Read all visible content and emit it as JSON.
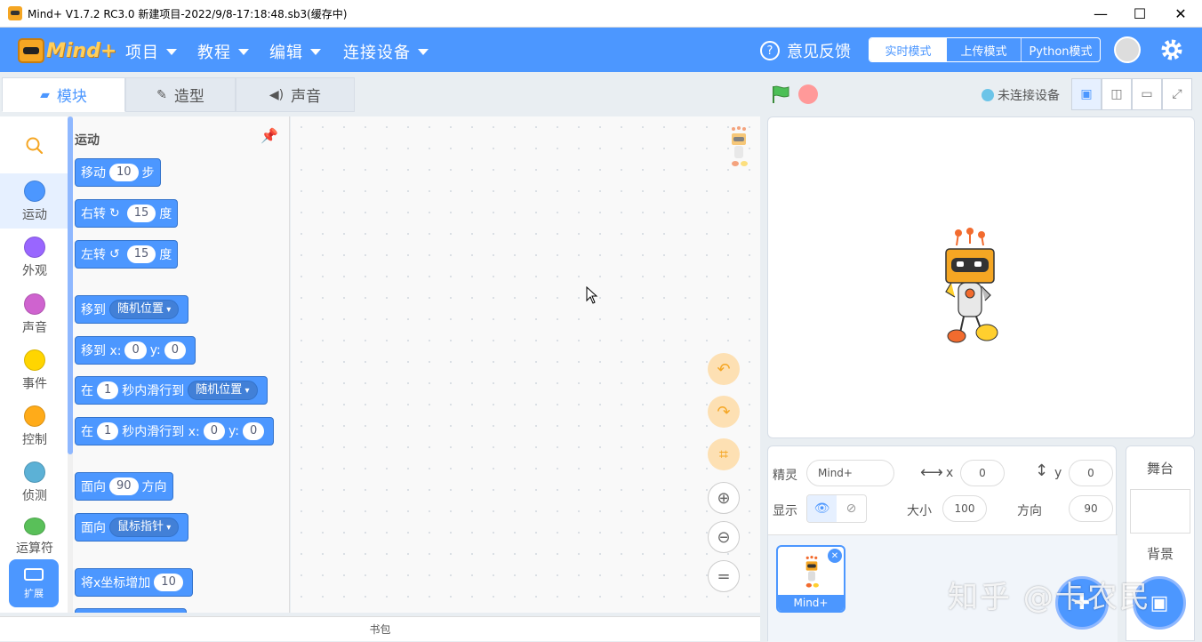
{
  "window": {
    "title": "Mind+ V1.7.2 RC3.0   新建项目-2022/9/8-17:18:48.sb3(缓存中)",
    "minimize": "—",
    "maximize": "☐",
    "close": "✕"
  },
  "menubar": {
    "logo_text": "Mind+",
    "items": [
      "项目",
      "教程",
      "编辑",
      "连接设备"
    ],
    "feedback": "意见反馈",
    "modes": [
      "实时模式",
      "上传模式",
      "Python模式"
    ],
    "active_mode": "实时模式"
  },
  "tabs": [
    {
      "label": "模块",
      "icon": "blocks-icon"
    },
    {
      "label": "造型",
      "icon": "brush-icon"
    },
    {
      "label": "声音",
      "icon": "speaker-icon"
    }
  ],
  "categories": [
    {
      "label": "运动",
      "color": "#4c97ff"
    },
    {
      "label": "外观",
      "color": "#9966ff"
    },
    {
      "label": "声音",
      "color": "#cf63cf"
    },
    {
      "label": "事件",
      "color": "#ffd500"
    },
    {
      "label": "控制",
      "color": "#ffab19"
    },
    {
      "label": "侦测",
      "color": "#5cb1d6"
    },
    {
      "label": "运算符",
      "color": "#59c059"
    }
  ],
  "extension_label": "扩展",
  "palette": {
    "title": "运动",
    "blocks": {
      "move": {
        "a": "移动",
        "v": "10",
        "b": "步"
      },
      "turn_right": {
        "a": "右转",
        "v": "15",
        "b": "度"
      },
      "turn_left": {
        "a": "左转",
        "v": "15",
        "b": "度"
      },
      "goto": {
        "a": "移到",
        "dd": "随机位置"
      },
      "goto_xy": {
        "a": "移到 x:",
        "x": "0",
        "b": "y:",
        "y": "0"
      },
      "glide": {
        "a": "在",
        "v": "1",
        "b": "秒内滑行到",
        "dd": "随机位置"
      },
      "glide_xy": {
        "a": "在",
        "v": "1",
        "b": "秒内滑行到 x:",
        "x": "0",
        "c": "y:",
        "y": "0"
      },
      "point_dir": {
        "a": "面向",
        "v": "90",
        "b": "方向"
      },
      "point_towards": {
        "a": "面向",
        "dd": "鼠标指针"
      },
      "change_x": {
        "a": "将x坐标增加",
        "v": "10"
      }
    }
  },
  "backpack_label": "书包",
  "stage_header": {
    "connection": "未连接设备"
  },
  "sprite_info": {
    "sprite_label": "精灵",
    "sprite_name": "Mind+",
    "x_label": "x",
    "x_value": "0",
    "y_label": "y",
    "y_value": "0",
    "show_label": "显示",
    "size_label": "大小",
    "size_value": "100",
    "direction_label": "方向",
    "direction_value": "90"
  },
  "sprite_list": [
    {
      "name": "Mind+"
    }
  ],
  "stage_panel": {
    "title": "舞台",
    "backdrop_label": "背景"
  },
  "watermark": "知乎 @卡农民",
  "colors": {
    "accent": "#4c97ff",
    "motion": "#4c97ff"
  }
}
